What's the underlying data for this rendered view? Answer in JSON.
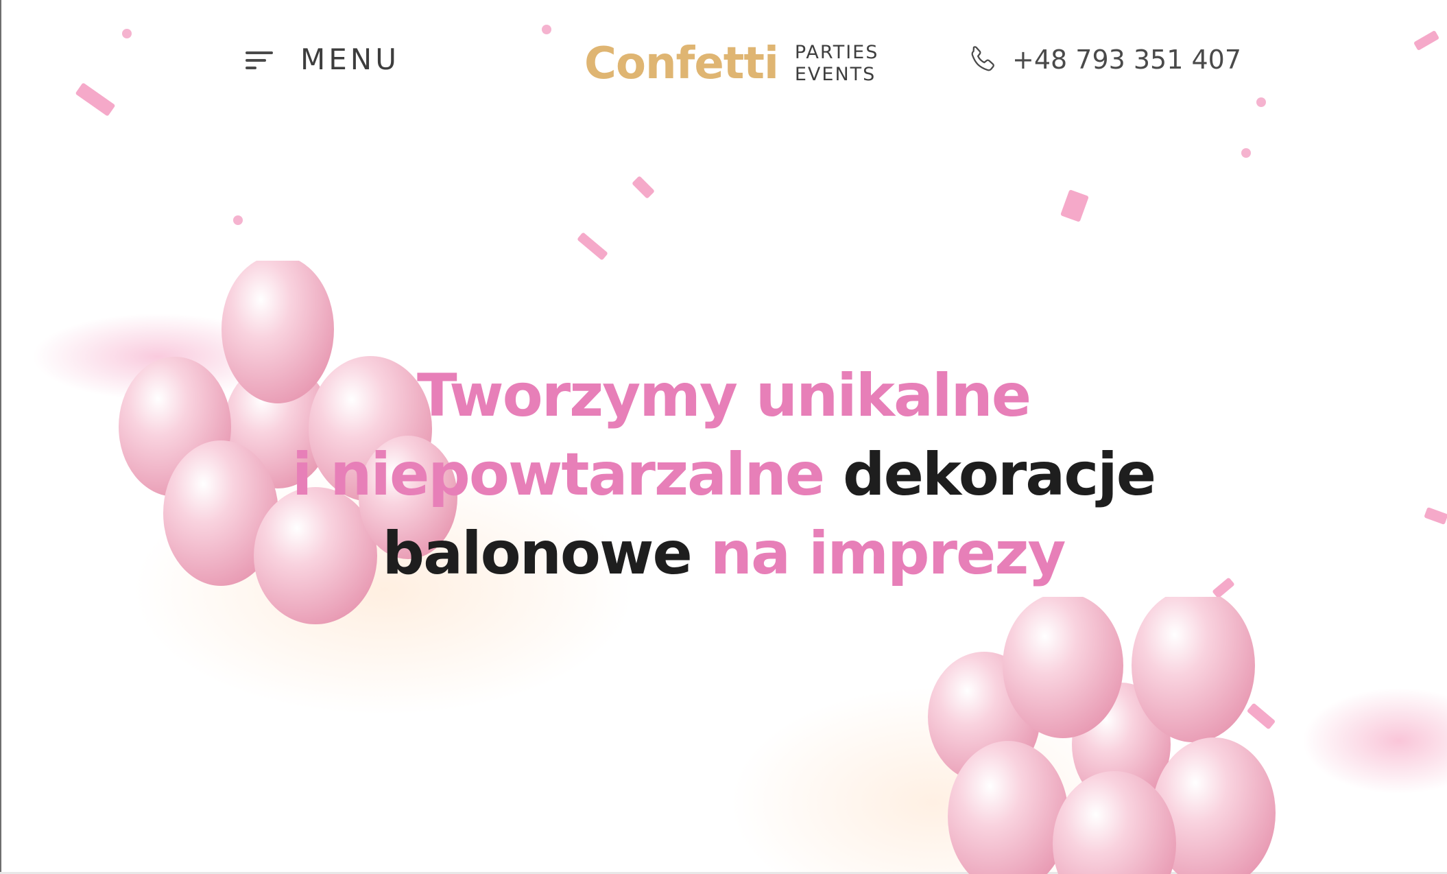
{
  "header": {
    "menu_label": "MENU",
    "logo": {
      "word": "Confetti",
      "sub_line_1": "PARTIES",
      "sub_line_2": "EVENTS"
    },
    "phone_number": "+48 793 351 407"
  },
  "hero": {
    "line1_pink": "Tworzymy unikalne",
    "line2_pink": "i niepowtarzalne",
    "line2_dark": "dekoracje",
    "line3_dark": "balonowe",
    "line3_pink": "na imprezy"
  },
  "colors": {
    "accent_pink": "#e77fb8",
    "logo_gold": "#dfb572",
    "text_dark": "#1e1e1e",
    "balloon_pink": "#f2b8cc"
  },
  "icons": [
    "menu-icon",
    "phone-icon",
    "balloons-illustration",
    "confetti"
  ]
}
